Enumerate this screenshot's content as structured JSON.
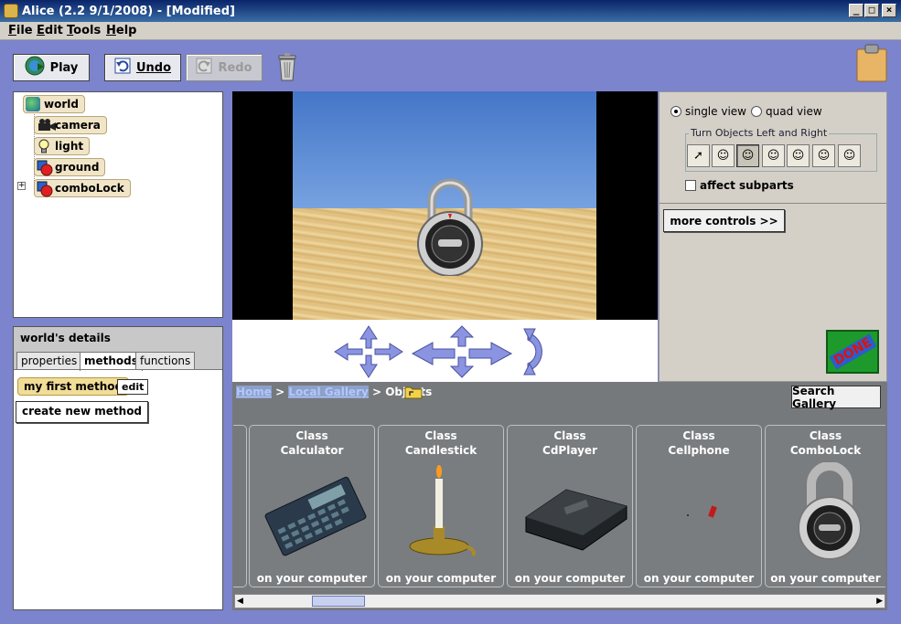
{
  "window": {
    "title": "Alice (2.2  9/1/2008) - [Modified]",
    "controls": {
      "minimize": "_",
      "maximize": "□",
      "close": "×"
    }
  },
  "menu": [
    "File",
    "Edit",
    "Tools",
    "Help"
  ],
  "toolbar": {
    "play": "Play",
    "undo": "Undo",
    "redo": "Redo"
  },
  "tree": {
    "root": "world",
    "children": [
      "camera",
      "light",
      "ground",
      "comboLock"
    ],
    "expandable": "comboLock"
  },
  "details": {
    "title": "world's details",
    "tabs": [
      "properties",
      "methods",
      "functions"
    ],
    "active_tab": "methods",
    "method": "my first method",
    "edit": "edit",
    "create": "create new method"
  },
  "view_controls": {
    "single_view": "single view",
    "quad_view": "quad view",
    "selected_view": "single view",
    "group_label": "Turn Objects Left and Right",
    "affect_subparts": "affect subparts",
    "more_controls": "more controls  >>",
    "done": "DONE"
  },
  "gallery": {
    "breadcrumb": {
      "home": "Home",
      "sep1": " > ",
      "local": "Local Gallery",
      "sep2": " > ",
      "current": "Objects"
    },
    "search": "Search Gallery",
    "items": [
      {
        "class": "Class",
        "name": "Calculator",
        "location": "on your computer"
      },
      {
        "class": "Class",
        "name": "Candlestick",
        "location": "on your computer"
      },
      {
        "class": "Class",
        "name": "CdPlayer",
        "location": "on your computer"
      },
      {
        "class": "Class",
        "name": "Cellphone",
        "location": "on your computer"
      },
      {
        "class": "Class",
        "name": "ComboLock",
        "location": "on your computer"
      }
    ]
  },
  "colors": {
    "background": "#7b84cc",
    "titlebar": "#0a246a",
    "done_green": "#1d9a2b"
  }
}
